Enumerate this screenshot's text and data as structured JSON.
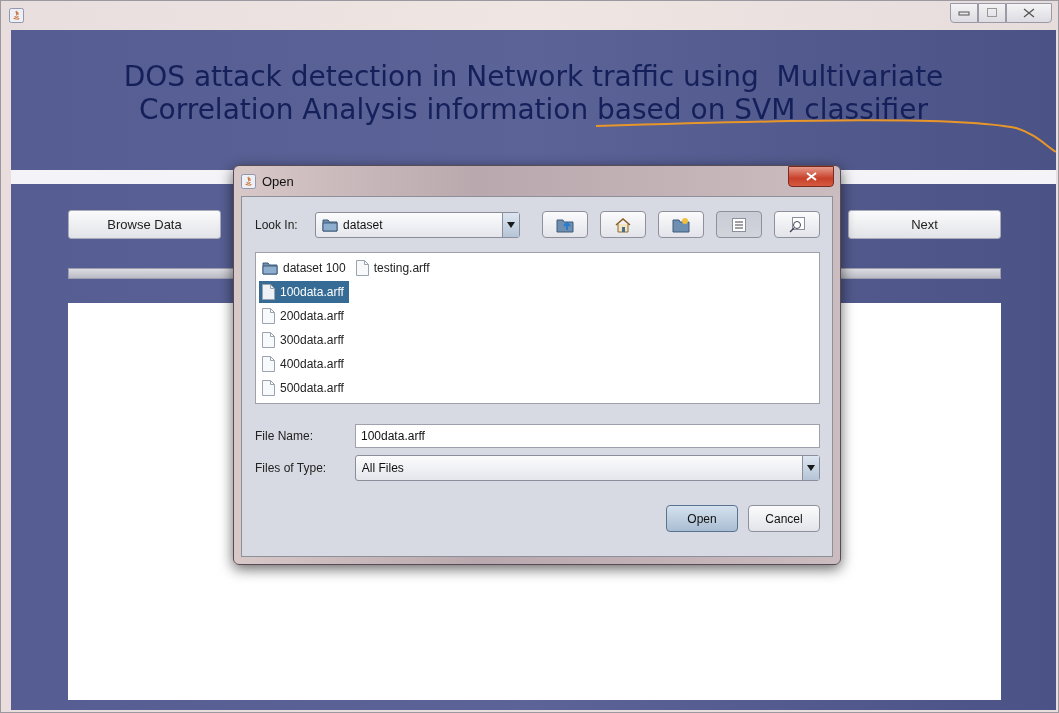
{
  "app": {
    "title_lines": [
      "DOS attack detection in Network traffic using  Multivariate",
      "Correlation Analysis information based on SVM classifier"
    ],
    "buttons": [
      "Browse Data",
      "Next"
    ]
  },
  "dialog": {
    "title": "Open",
    "look_in": {
      "label": "Look In:",
      "value": "dataset"
    },
    "toolbar": [
      {
        "kind": "up",
        "pressed": false
      },
      {
        "kind": "home",
        "pressed": false
      },
      {
        "kind": "new-folder",
        "pressed": false
      },
      {
        "kind": "list",
        "pressed": true
      },
      {
        "kind": "details",
        "pressed": false
      }
    ],
    "files": [
      {
        "name": "dataset 100",
        "kind": "folder",
        "selected": false
      },
      {
        "name": "100data.arff",
        "kind": "file",
        "selected": true
      },
      {
        "name": "200data.arff",
        "kind": "file",
        "selected": false
      },
      {
        "name": "300data.arff",
        "kind": "file",
        "selected": false
      },
      {
        "name": "400data.arff",
        "kind": "file",
        "selected": false
      },
      {
        "name": "500data.arff",
        "kind": "file",
        "selected": false
      },
      {
        "name": "testing.arff",
        "kind": "file",
        "selected": false
      }
    ],
    "file_name": {
      "label": "File Name:",
      "value": "100data.arff"
    },
    "file_type": {
      "label": "Files of Type:",
      "value": "All Files"
    },
    "buttons": [
      {
        "label": "Open",
        "default": true
      },
      {
        "label": "Cancel",
        "default": false
      }
    ]
  }
}
